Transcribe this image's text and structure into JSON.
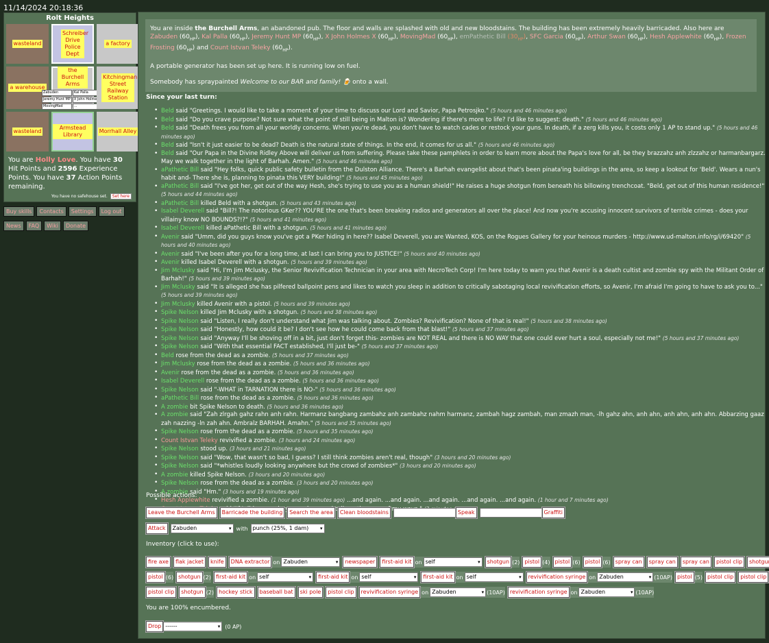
{
  "timestamp": "11/14/2024 20:18:36",
  "map": {
    "title": "Rolt Heights",
    "cells": [
      {
        "label": "wasteland"
      },
      {
        "label": "Schreiber Drive Police Dept"
      },
      {
        "label": "a factory"
      },
      {
        "label": "a warehouse"
      },
      {
        "label": "the Burchell Arms"
      },
      {
        "label": "Kitchingman Street Railway Station"
      },
      {
        "label": "wasteland"
      },
      {
        "label": "Armstead Library"
      },
      {
        "label": "Morrhall Alley"
      }
    ],
    "center_names": [
      "Zabuden",
      "Kal Palla",
      "Jeremy Hunt MP",
      "X John Holmes X",
      "MovingMad",
      "..."
    ]
  },
  "status": {
    "p1": "You are ",
    "name": "Holly Love",
    "p2": ". You have ",
    "hp": "30",
    "p3": " Hit Points and ",
    "xp": "2596",
    "p4": " Experience Points. You have ",
    "ap": "37",
    "p5": " Action Points remaining."
  },
  "safehouse": {
    "text": "You have no safehouse set.",
    "button": "Set here"
  },
  "links": {
    "row1": [
      "Buy skills",
      "Contacts",
      "Settings",
      "Log out"
    ],
    "row2": [
      "News",
      "FAQ",
      "Wiki",
      "Donate"
    ]
  },
  "description": {
    "intro": "You are inside ",
    "place": "the Burchell Arms",
    "rest": ", an abandoned pub. The floor and walls are splashed with old and new bloodstains. The building has been extremely heavily barricaded. Also here are ",
    "generator": "A portable generator has been set up here. It is running low on fuel.",
    "spray_pre": "Somebody has spraypainted ",
    "spray_msg": "Welcome to our BAR and family! 🍺",
    "spray_post": " onto a wall."
  },
  "since_title": "Since your last turn:",
  "possible_actions_title": "Possible actions:",
  "actions": {
    "leave": "Leave the Burchell Arms",
    "barricade": "Barricade the building",
    "search": "Search the area",
    "clean": "Clean bloodstains",
    "speak": "Speak",
    "graffiti": "Graffiti",
    "attack": "Attack",
    "attack_target": "Zabuden",
    "with": "with",
    "weapon": "punch (25%, 1 dam)"
  },
  "inventory_title": "Inventory (click to use):",
  "encumbrance": "You are 100% encumbered.",
  "drop": {
    "label": "Drop",
    "value": "------",
    "cost": "(0 AP)"
  }
}
